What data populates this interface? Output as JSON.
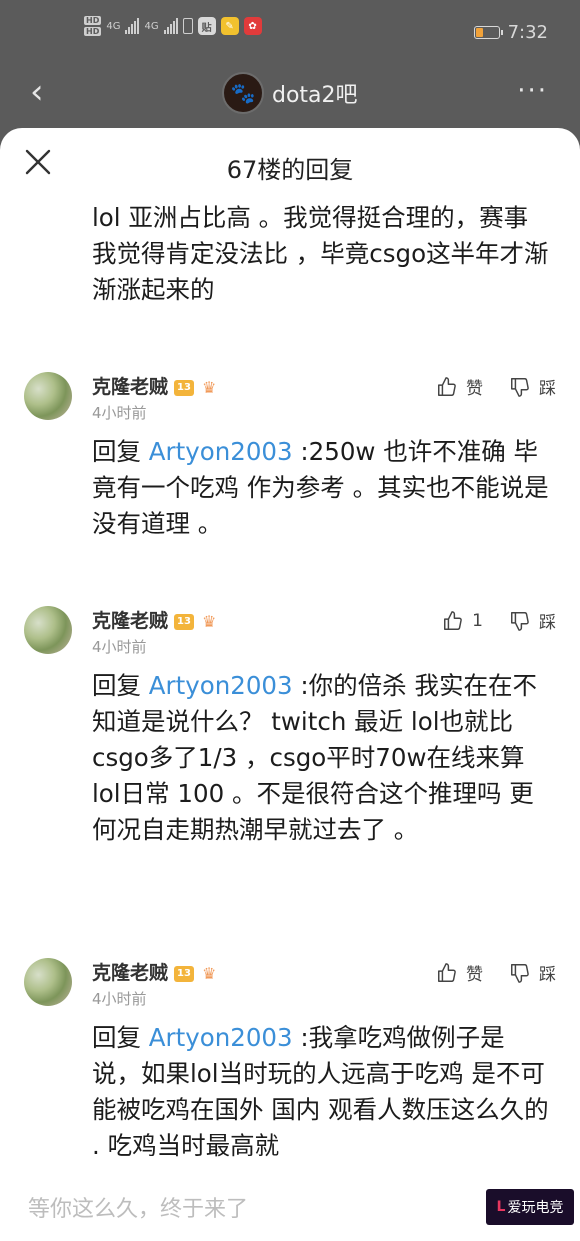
{
  "status_bar": {
    "hd_top": "HD",
    "hd_bottom": "HD",
    "net1": "4G",
    "net2": "4G",
    "app1": "贴",
    "time": "7:32",
    "battery_level": 0.3
  },
  "topbar": {
    "forum_name": "dota2吧"
  },
  "sheet": {
    "title": "67楼的回复",
    "intro_text": "lol 亚洲占比高 。我觉得挺合理的，赛事 我觉得肯定没法比 ，毕竟csgo这半年才渐渐涨起来的"
  },
  "replies": [
    {
      "author": "克隆老贼",
      "level": "13",
      "time": "4小时前",
      "like_label": "赞",
      "dislike_label": "踩",
      "reply_prefix": "回复 ",
      "mention": "Artyon2003",
      "text": " :250w 也许不准确 毕竟有一个吃鸡 作为参考 。其实也不能说是没有道理 。"
    },
    {
      "author": "克隆老贼",
      "level": "13",
      "time": "4小时前",
      "like_label": "1",
      "dislike_label": "踩",
      "reply_prefix": "回复 ",
      "mention": "Artyon2003",
      "text": " :你的倍杀 我实在在不知道是说什么？ twitch 最近 lol也就比csgo多了1/3 ，csgo平时70w在线来算 lol日常 100 。不是很符合这个推理吗 更何况自走期热潮早就过去了 。"
    },
    {
      "author": "克隆老贼",
      "level": "13",
      "time": "4小时前",
      "like_label": "赞",
      "dislike_label": "踩",
      "reply_prefix": "回复 ",
      "mention": "Artyon2003",
      "text": " :我拿吃鸡做例子是说，如果lol当时玩的人远高于吃鸡 是不可能被吃鸡在国外 国内 观看人数压这么久的 . 吃鸡当时最高就"
    }
  ],
  "bottom": {
    "input_placeholder": "等你这么久，终于来了"
  },
  "watermark": {
    "left": "L",
    "text": "爱玩电竞"
  }
}
